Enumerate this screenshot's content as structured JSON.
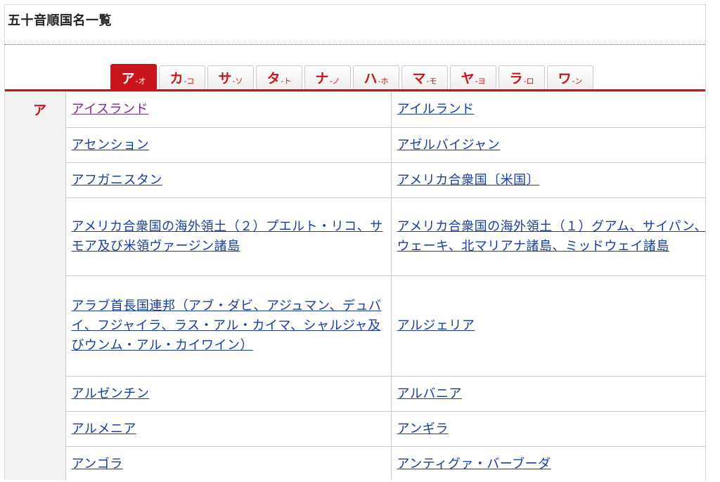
{
  "page": {
    "title": "五十音順国名一覧"
  },
  "tabs": [
    {
      "main": "ア",
      "sub": "-オ",
      "active": true
    },
    {
      "main": "カ",
      "sub": "-コ",
      "active": false
    },
    {
      "main": "サ",
      "sub": "-ソ",
      "active": false
    },
    {
      "main": "タ",
      "sub": "-ト",
      "active": false
    },
    {
      "main": "ナ",
      "sub": "-ノ",
      "active": false
    },
    {
      "main": "ハ",
      "sub": "-ホ",
      "active": false
    },
    {
      "main": "マ",
      "sub": "-モ",
      "active": false
    },
    {
      "main": "ヤ",
      "sub": "-ヨ",
      "active": false
    },
    {
      "main": "ラ",
      "sub": "-ロ",
      "active": false
    },
    {
      "main": "ワ",
      "sub": "-ン",
      "active": false
    }
  ],
  "section": {
    "kana": "ア"
  },
  "rows": [
    {
      "left": "アイスランド",
      "right": "アイルランド"
    },
    {
      "left": "アセンション",
      "right": "アゼルバイジャン"
    },
    {
      "left": "アフガニスタン",
      "right": "アメリカ合衆国〔米国〕"
    },
    {
      "left": "アメリカ合衆国の海外領土（２）プエルト・リコ、サモア及び米領ヴァージン諸島",
      "right": "アメリカ合衆国の海外領土（１）グアム、サイパン、ウェーキ、北マリアナ諸島、ミッドウェイ諸島"
    },
    {
      "left": "アラブ首長国連邦（アブ・ダビ、アジュマン、デュバイ、フジャイラ、ラス・アル・カイマ、シャルジャ及びウンム・アル・カイワイン）",
      "right": "アルジェリア"
    },
    {
      "left": "アルゼンチン",
      "right": "アルバニア"
    },
    {
      "left": "アルメニア",
      "right": "アンギラ"
    },
    {
      "left": "アンゴラ",
      "right": "アンティグァ・バーブーダ"
    }
  ],
  "colors": {
    "accent": "#c8151b",
    "link": "#1a3c9c",
    "visited_link": "#7a2a8c",
    "kana_column_bg": "#f2f2f2"
  }
}
